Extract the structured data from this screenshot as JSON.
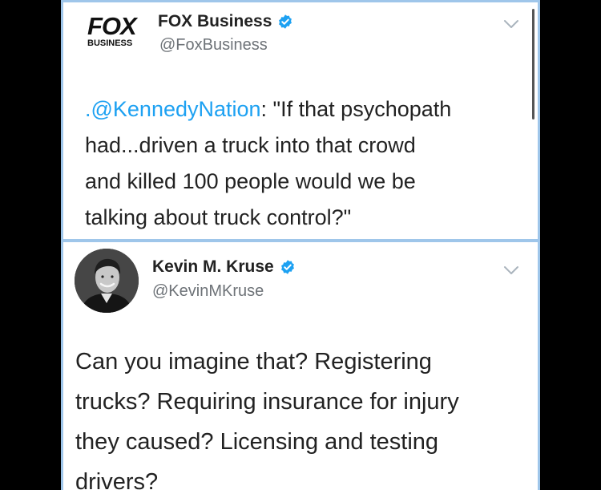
{
  "tweet1": {
    "logo": {
      "top": "FOX",
      "bottom": "BUSINESS"
    },
    "name": "FOX Business",
    "handle": "@FoxBusiness",
    "mention": ".@KennedyNation",
    "lines": [
      ": \"If that psychopath",
      "had...driven a truck into that crowd",
      "and killed 100 people would we be",
      "talking about truck control?\""
    ]
  },
  "tweet2": {
    "name": "Kevin M. Kruse",
    "handle": "@KevinMKruse",
    "lines": [
      "Can you imagine that? Registering",
      "trucks? Requiring insurance for injury",
      "they caused? Licensing and testing",
      "drivers?"
    ]
  },
  "colors": {
    "frame_border": "#9fc6ea",
    "verified": "#1da1f2",
    "mention": "#1da1f2",
    "handle": "#6e7378",
    "text": "#222222"
  },
  "icons": [
    "verified-badge-icon",
    "chevron-down-icon",
    "fox-business-logo",
    "avatar"
  ]
}
